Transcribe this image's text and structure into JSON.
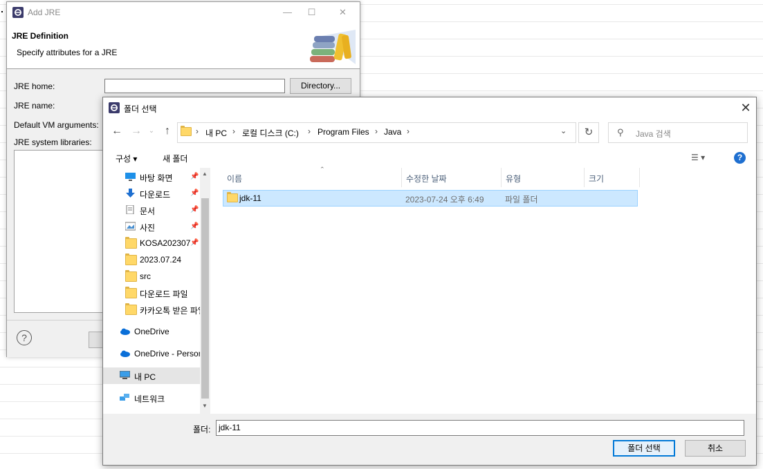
{
  "jre_dialog": {
    "title": "Add JRE",
    "header_title": "JRE Definition",
    "header_desc": "Specify attributes for a JRE",
    "labels": {
      "jre_home": "JRE home:",
      "jre_name": "JRE name:",
      "vm_args": "Default VM arguments:",
      "system_libs": "JRE system libraries:"
    },
    "jre_home_value": "",
    "directory_button": "Directory...",
    "help_symbol": "?"
  },
  "picker": {
    "title": "폴더 선택",
    "breadcrumb": [
      "내 PC",
      "로컬 디스크 (C:)",
      "Program Files",
      "Java"
    ],
    "search_placeholder": "Java 검색",
    "toolbar": {
      "organize": "구성 ▾",
      "new_folder": "새 폴더"
    },
    "nav_items": [
      {
        "label": "바탕 화면",
        "icon": "desktop-icon",
        "pinned": true
      },
      {
        "label": "다운로드",
        "icon": "download-icon",
        "pinned": true
      },
      {
        "label": "문서",
        "icon": "document-icon",
        "pinned": true
      },
      {
        "label": "사진",
        "icon": "picture-icon",
        "pinned": true
      },
      {
        "label": "KOSA202307",
        "icon": "folder-icon",
        "pinned": true
      },
      {
        "label": "2023.07.24",
        "icon": "folder-icon",
        "pinned": false
      },
      {
        "label": "src",
        "icon": "folder-icon",
        "pinned": false
      },
      {
        "label": "다운로드 파일",
        "icon": "folder-icon",
        "pinned": false
      },
      {
        "label": "카카오톡 받은 파일",
        "icon": "folder-icon",
        "pinned": false
      }
    ],
    "nav_roots": [
      {
        "label": "OneDrive",
        "icon": "onedrive-icon"
      },
      {
        "label": "OneDrive - Personal",
        "icon": "onedrive-icon"
      },
      {
        "label": "내 PC",
        "icon": "pc-icon",
        "selected": true
      },
      {
        "label": "네트워크",
        "icon": "network-icon"
      }
    ],
    "columns": [
      "이름",
      "수정한 날짜",
      "유형",
      "크기"
    ],
    "files": [
      {
        "name": "jdk-11",
        "date": "2023-07-24 오후 6:49",
        "type": "파일 폴더",
        "size": ""
      }
    ],
    "folder_label": "폴더:",
    "folder_value": "jdk-11",
    "select_button": "폴더 선택",
    "cancel_button": "취소"
  },
  "colors": {
    "accent": "#0078d7",
    "selection": "#cce8ff",
    "header_text": "#4c607a"
  }
}
